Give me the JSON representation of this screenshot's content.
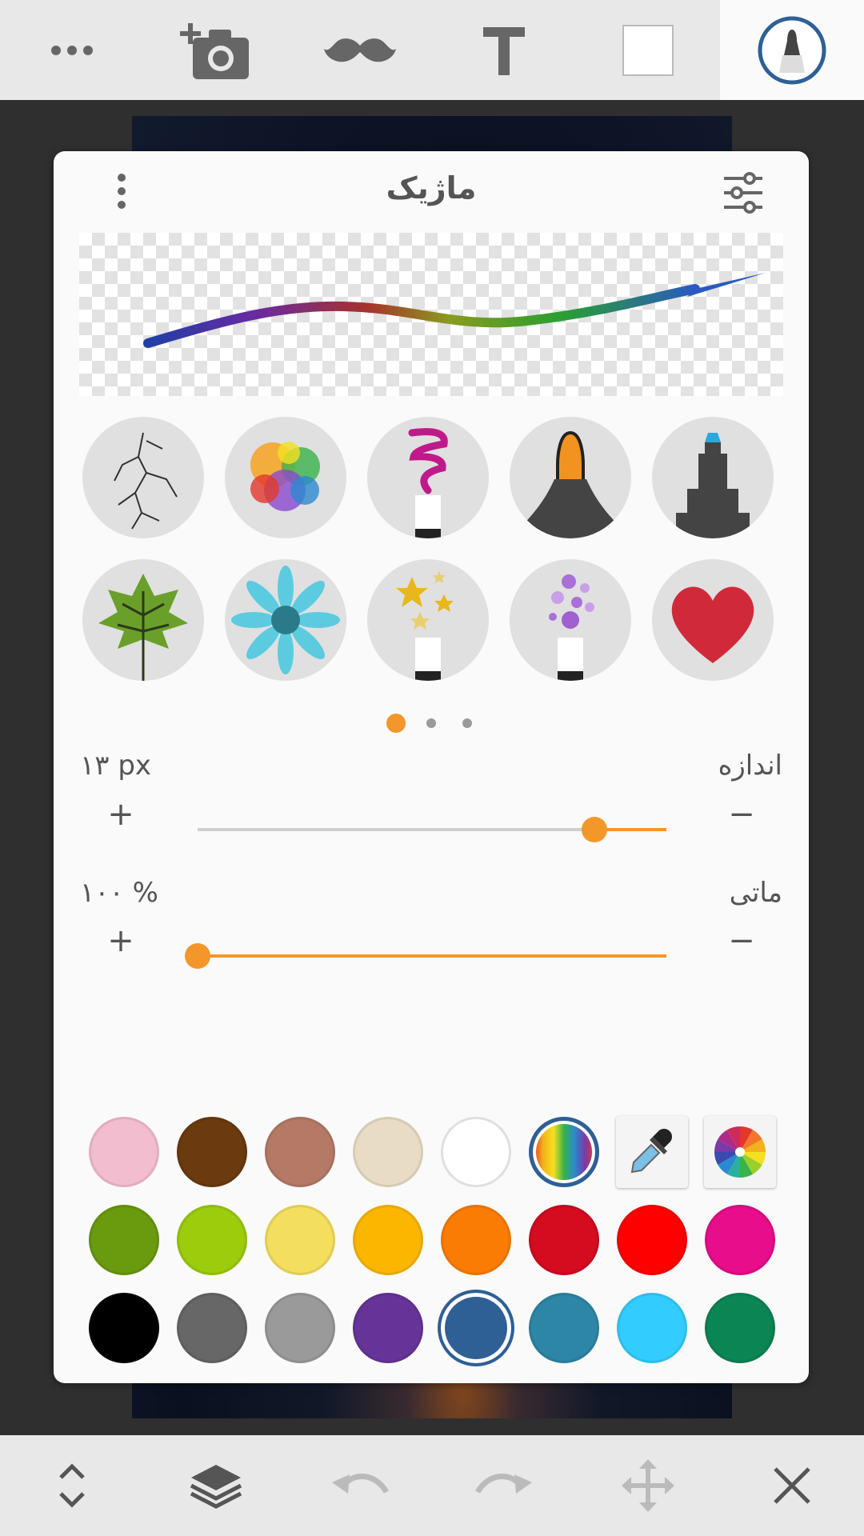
{
  "toolbar": {
    "items": [
      "more-icon",
      "add-photo-icon",
      "sticker-mustache-icon",
      "text-icon",
      "shape-icon",
      "brush-icon"
    ]
  },
  "panel": {
    "title": "ماژیک",
    "size_label": "اندازه",
    "size_value": "۱۳ px",
    "size_level": 0.84,
    "opacity_label": "ماتی",
    "opacity_value": "۱۰۰ %",
    "opacity_level": 1.0,
    "plus": "+",
    "minus": "−",
    "page_indicator": {
      "count": 3,
      "active": 0
    }
  },
  "brushes": [
    "crack-brush",
    "color-splash-brush",
    "swirl-marker-brush",
    "orange-tip-brush",
    "blue-tip-brush",
    "leaf-brush",
    "flower-brush",
    "stars-brush",
    "bubbles-brush",
    "heart-brush"
  ],
  "colors": {
    "accent": "#f4972a",
    "row1": [
      "#f3bdd0",
      "#6b3a0f",
      "#b57a66",
      "#e8dcc4",
      "#ffffff",
      "rainbow",
      "eyedropper",
      "color-wheel"
    ],
    "row2": [
      "#6a9a0d",
      "#9ccc0c",
      "#f4de5e",
      "#fbb700",
      "#fb7c04",
      "#d50b20",
      "#ff0000",
      "#e80d8a"
    ],
    "row3": [
      "#000000",
      "#676767",
      "#9a9a9a",
      "#663399",
      "#2e6095",
      "#2e86a6",
      "#33ccff",
      "#0c8555"
    ],
    "selected": "#2e6095"
  },
  "bottombar": {
    "items": [
      "expand-collapse-icon",
      "layers-icon",
      "undo-icon",
      "redo-icon",
      "move-icon",
      "close-icon"
    ]
  }
}
